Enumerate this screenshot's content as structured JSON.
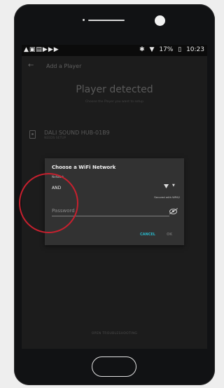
{
  "status_bar": {
    "left_icons": "▲▣▤▶▶▶",
    "bluetooth": "✱",
    "wifi": "▼",
    "battery": "17%",
    "time": "10:23"
  },
  "app_bar": {
    "title": "Add a Player"
  },
  "background": {
    "title": "Player detected",
    "subtitle": "Choose the Player you want to setup",
    "device_name": "DALI SOUND HUB-01B9",
    "device_sub": "NEEDS SETUP",
    "footer_link": "OPEN TROUBLESHOOTING"
  },
  "dialog": {
    "title": "Choose a WiFi Network",
    "network_label": "Network",
    "network_value": "AND",
    "secured_text": "Secured with WPA2",
    "password_placeholder": "Password",
    "cancel_label": "CANCEL",
    "ok_label": "OK"
  },
  "colors": {
    "accent": "#29b6c8",
    "annotation": "#c8202e",
    "dialog_bg": "#323232",
    "screen_bg": "#1c1c1c"
  }
}
